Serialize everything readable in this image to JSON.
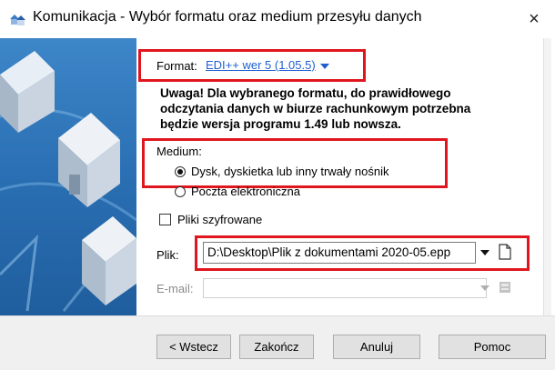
{
  "window": {
    "title": "Komunikacja - Wybór formatu oraz medium przesyłu danych",
    "close_glyph": "×",
    "app_icon": "houses-icon"
  },
  "format": {
    "label": "Format:",
    "value": "EDI++ wer 5 (1.05.5)"
  },
  "warning": "Uwaga! Dla wybranego formatu, do prawidłowego odczytania danych w biurze rachunkowym potrzebna będzie wersja programu 1.49 lub nowsza.",
  "medium": {
    "label": "Medium:",
    "options": [
      {
        "label": "Dysk, dyskietka lub inny trwały nośnik",
        "checked": true
      },
      {
        "label": "Poczta elektroniczna",
        "checked": false
      }
    ]
  },
  "encrypted": {
    "label": "Pliki szyfrowane",
    "checked": false
  },
  "file": {
    "label": "Plik:",
    "value": "D:\\Desktop\\Plik z dokumentami 2020-05.epp",
    "browse_icon": "document-icon"
  },
  "email": {
    "label": "E-mail:",
    "value": "",
    "icon": "address-book-icon"
  },
  "buttons": {
    "back": "< Wstecz",
    "finish": "Zakończ",
    "cancel": "Anuluj",
    "help": "Pomoc"
  },
  "colors": {
    "highlight": "#e0161f",
    "link": "#1f5fd1",
    "panel_blue": "#2f7bc0"
  }
}
